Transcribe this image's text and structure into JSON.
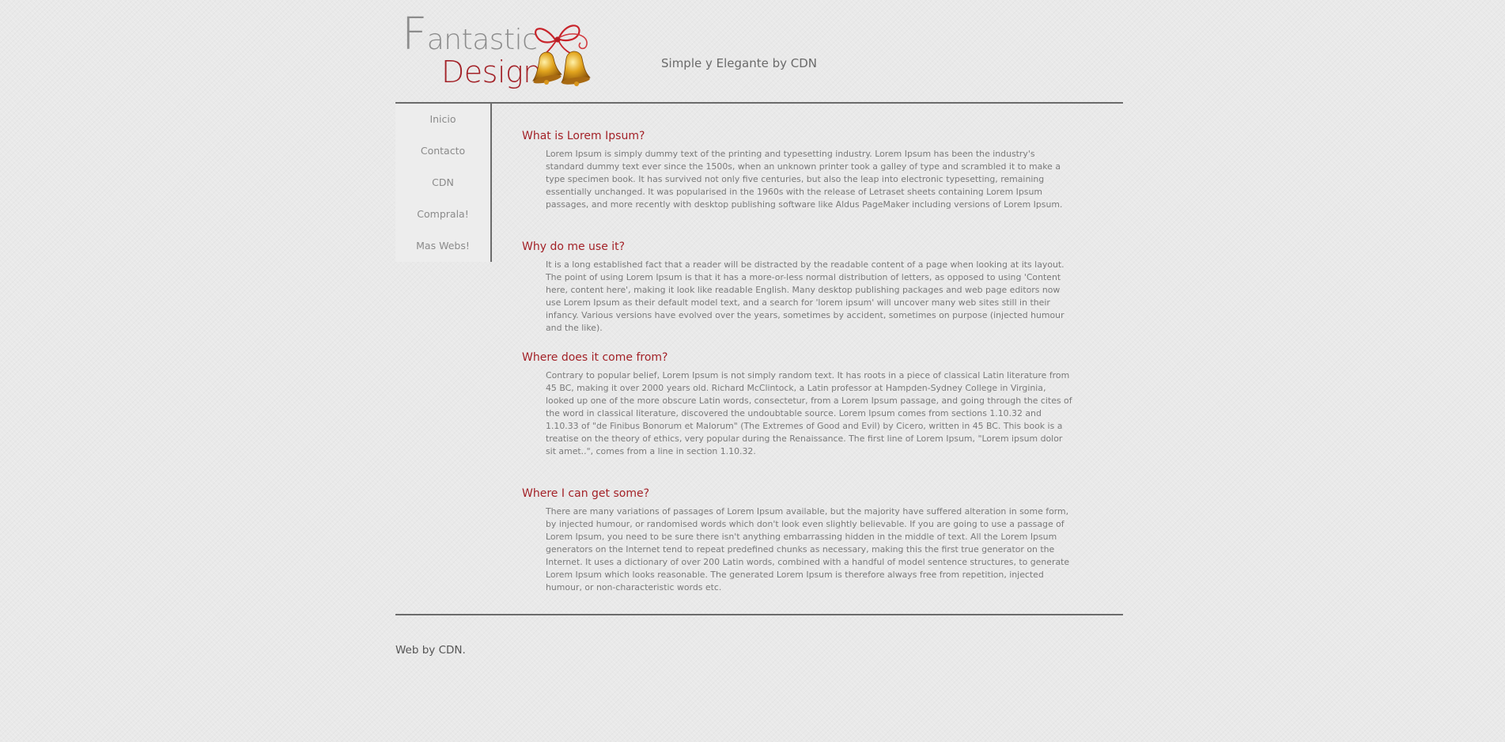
{
  "header": {
    "logo_line1_initial": "F",
    "logo_line1_rest": "antastic",
    "logo_line2": "Design",
    "tagline": "Simple y Elegante by CDN"
  },
  "sidebar": {
    "items": [
      {
        "label": "Inicio"
      },
      {
        "label": "Contacto"
      },
      {
        "label": "CDN"
      },
      {
        "label": "Comprala!"
      },
      {
        "label": "Mas Webs!"
      }
    ]
  },
  "main": {
    "sections": [
      {
        "title": "What is Lorem Ipsum?",
        "body": "Lorem Ipsum is simply dummy text of the printing and typesetting industry. Lorem Ipsum has been the industry's standard dummy text ever since the 1500s, when an unknown printer took a galley of type and scrambled it to make a type specimen book. It has survived not only five centuries, but also the leap into electronic typesetting, remaining essentially unchanged. It was popularised in the 1960s with the release of Letraset sheets containing Lorem Ipsum passages, and more recently with desktop publishing software like Aldus PageMaker including versions of Lorem Ipsum."
      },
      {
        "title": "Why do me use it?",
        "body": "It is a long established fact that a reader will be distracted by the readable content of a page when looking at its layout. The point of using Lorem Ipsum is that it has a more-or-less normal distribution of letters, as opposed to using 'Content here, content here', making it look like readable English. Many desktop publishing packages and web page editors now use Lorem Ipsum as their default model text, and a search for 'lorem ipsum' will uncover many web sites still in their infancy. Various versions have evolved over the years, sometimes by accident, sometimes on purpose (injected humour and the like)."
      },
      {
        "title": "Where does it come from?",
        "body": "Contrary to popular belief, Lorem Ipsum is not simply random text. It has roots in a piece of classical Latin literature from 45 BC, making it over 2000 years old. Richard McClintock, a Latin professor at Hampden-Sydney College in Virginia, looked up one of the more obscure Latin words, consectetur, from a Lorem Ipsum passage, and going through the cites of the word in classical literature, discovered the undoubtable source. Lorem Ipsum comes from sections 1.10.32 and 1.10.33 of \"de Finibus Bonorum et Malorum\" (The Extremes of Good and Evil) by Cicero, written in 45 BC. This book is a treatise on the theory of ethics, very popular during the Renaissance. The first line of Lorem Ipsum, \"Lorem ipsum dolor sit amet..\", comes from a line in section 1.10.32."
      },
      {
        "title": "Where I can get some?",
        "body": "There are many variations of passages of Lorem Ipsum available, but the majority have suffered alteration in some form, by injected humour, or randomised words which don't look even slightly believable. If you are going to use a passage of Lorem Ipsum, you need to be sure there isn't anything embarrassing hidden in the middle of text. All the Lorem Ipsum generators on the Internet tend to repeat predefined chunks as necessary, making this the first true generator on the Internet. It uses a dictionary of over 200 Latin words, combined with a handful of model sentence structures, to generate Lorem Ipsum which looks reasonable. The generated Lorem Ipsum is therefore always free from repetition, injected humour, or non-characteristic words etc."
      }
    ]
  },
  "footer": {
    "text": "Web by CDN."
  },
  "colors": {
    "accent": "#a32228",
    "background": "#e9e9e9",
    "text": "#797979",
    "rule": "#6b6b6b"
  }
}
